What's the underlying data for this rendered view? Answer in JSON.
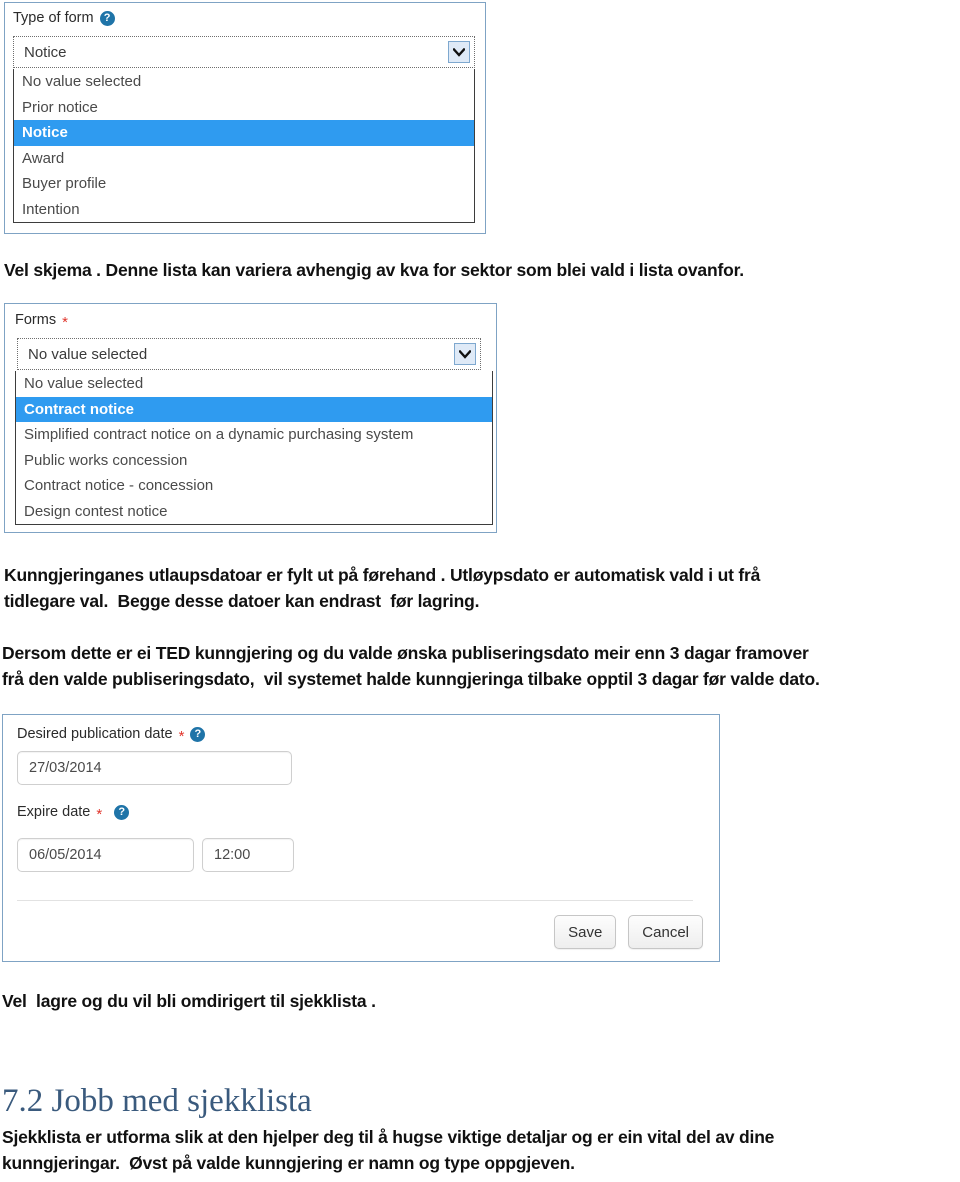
{
  "document": {
    "paragraphs": [
      {
        "id": "p1",
        "text": "Vel skjema . Denne lista kan variera avhengig av kva for sektor som blei vald i lista ovanfor."
      },
      {
        "id": "p2",
        "text": "Kunngjeringanes utlaupsdatoar er fylt ut på førehand . Utløypsdato er automatisk vald i ut frå\ntidlegare val.  Begge desse datoer kan endrast  før lagring."
      },
      {
        "id": "p3",
        "text": "Dersom dette er ei TED kunngjering og du valde ønska publiseringsdato meir enn 3 dagar framover\nfrå den valde publiseringsdato,  vil systemet halde kunngjeringa tilbake opptil 3 dagar før valde dato."
      },
      {
        "id": "p4",
        "text": "Vel  lagre og du vil bli omdirigert til sjekklista ."
      },
      {
        "id": "p5",
        "text": "Sjekklista er utforma slik at den hjelper deg til å hugse viktige detaljar og er ein vital del av dine\nkunngjeringar.  Øvst på valde kunngjering er namn og type oppgjeven."
      }
    ],
    "heading": {
      "number": "7.2",
      "text": "7.2 Jobb med sjekklista",
      "color": "#3a5a7d"
    }
  },
  "screenshot_type_of_form": {
    "label": "Type of form",
    "help_icon": "help-circle-icon",
    "select": {
      "value": "Notice",
      "arrow_icon": "chevron-down-icon"
    },
    "options": [
      {
        "label": "No value selected",
        "selected": false
      },
      {
        "label": "Prior notice",
        "selected": false
      },
      {
        "label": "Notice",
        "selected": true
      },
      {
        "label": "Award",
        "selected": false
      },
      {
        "label": "Buyer profile",
        "selected": false
      },
      {
        "label": "Intention",
        "selected": false
      }
    ]
  },
  "screenshot_forms": {
    "label": "Forms",
    "required_marker": "*",
    "select": {
      "value": "No value selected",
      "arrow_icon": "chevron-down-icon"
    },
    "options": [
      {
        "label": "No value selected",
        "selected": false
      },
      {
        "label": "Contract notice",
        "selected": true
      },
      {
        "label": "Simplified contract notice on a dynamic purchasing system",
        "selected": false
      },
      {
        "label": "Public works concession",
        "selected": false
      },
      {
        "label": "Contract notice - concession",
        "selected": false
      },
      {
        "label": "Design contest notice",
        "selected": false
      }
    ]
  },
  "screenshot_dates": {
    "publication": {
      "label": "Desired publication date",
      "required_marker": "*",
      "help_icon": "help-circle-icon",
      "value": "27/03/2014"
    },
    "expire": {
      "label": "Expire date",
      "required_marker": "*",
      "help_icon": "help-circle-icon",
      "date_value": "06/05/2014",
      "time_value": "12:00"
    },
    "buttons": {
      "save": "Save",
      "cancel": "Cancel"
    }
  },
  "colors": {
    "frame_border": "#7fa3c4",
    "highlight": "#2f9bf0",
    "heading": "#3a5a7d",
    "required": "#e0342b",
    "help_icon": "#1f74a8"
  }
}
